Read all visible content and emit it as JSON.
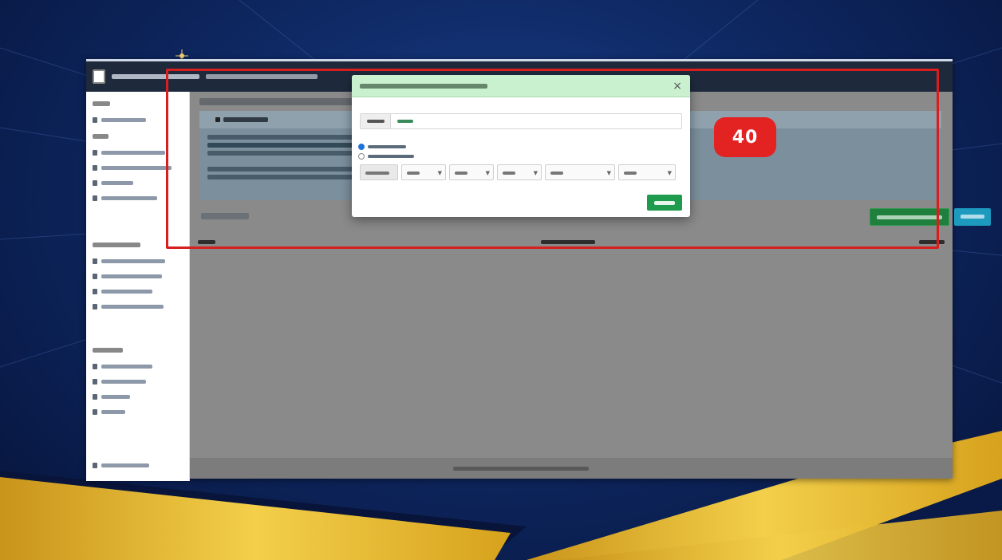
{
  "slide": {
    "step_number": "40"
  },
  "modal": {
    "close": "×"
  },
  "colors": {
    "slide_background": "#0f2a66",
    "gold_accent": "#e7b51c",
    "topbar": "#1e2a3c",
    "modal_header": "#c9f0cf",
    "primary_green": "#1f9b4d",
    "teal": "#1d9bbf",
    "highlight_red": "#d81e1e"
  }
}
